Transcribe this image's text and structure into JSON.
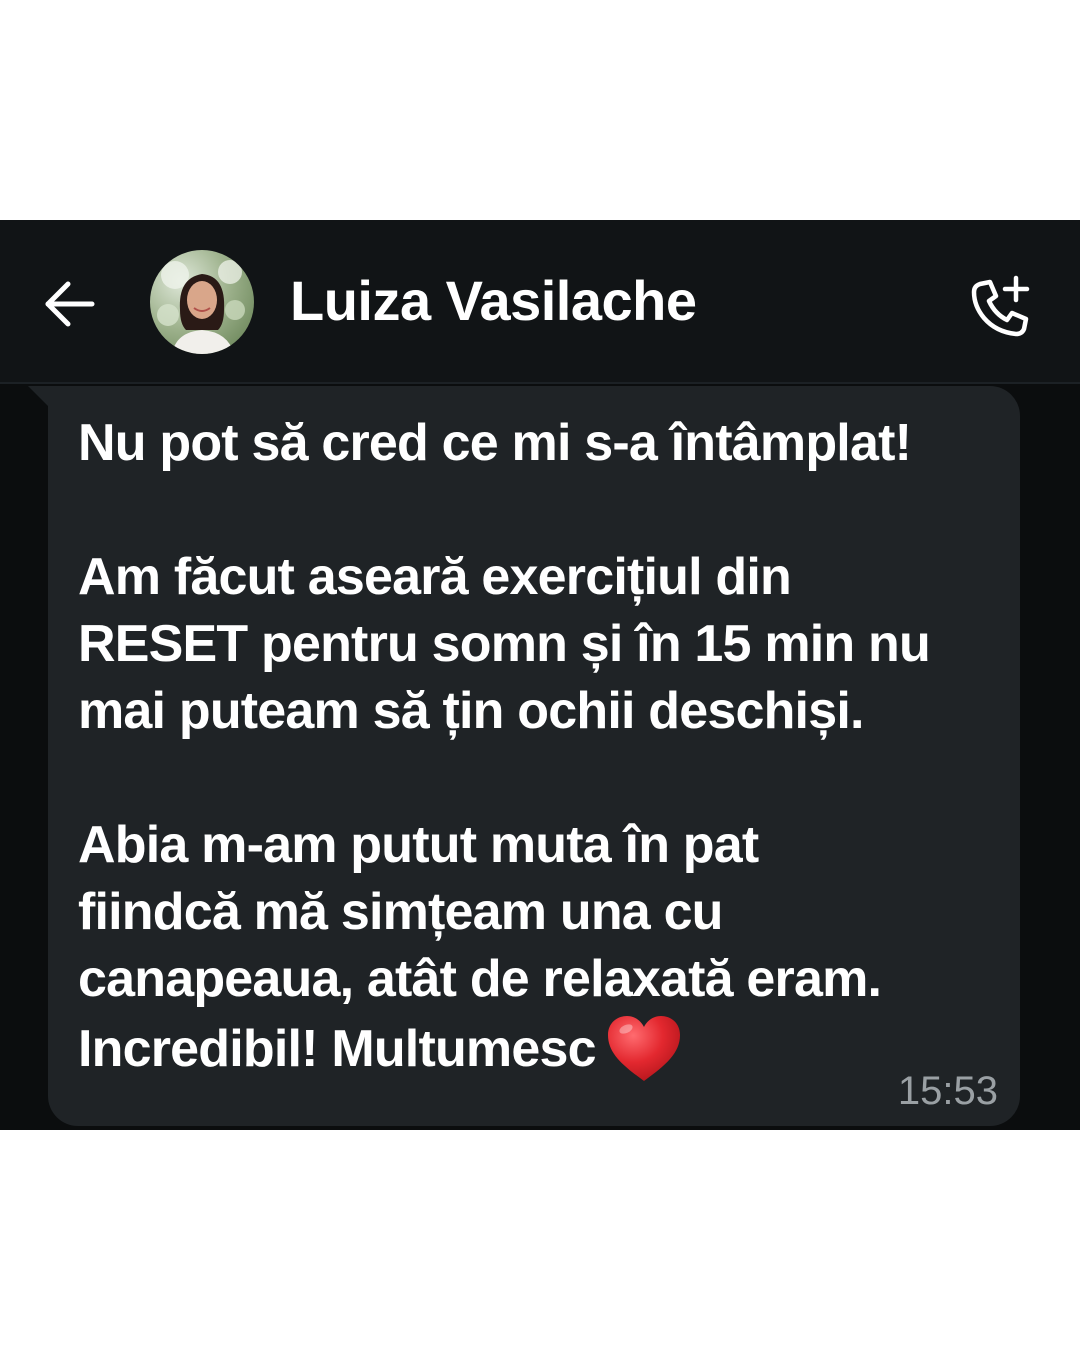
{
  "header": {
    "back_icon": "arrow-left-icon",
    "contact_name": "Luiza Vasilache",
    "call_icon": "phone-add-icon"
  },
  "message": {
    "line1": "Nu pot să cred ce mi s-a întâmplat!",
    "para2_line1": "Am făcut aseară exercițiul din",
    "para2_line2": "RESET pentru somn și în 15 min nu",
    "para2_line3": "mai puteam să țin ochii deschiși.",
    "para3_line1": "Abia m-am putut muta în pat",
    "para3_line2": "fiindcă mă simțeam una cu",
    "para3_line3": "canapeaua, atât de relaxată eram.",
    "para3_line4": "Incredibil! Multumesc",
    "emoji": "heart-icon",
    "time": "15:53"
  },
  "colors": {
    "background": "#0b0d0e",
    "header": "#111416",
    "bubble": "#1f2326",
    "text": "#ffffff",
    "timestamp": "#9aa0a4",
    "heart": "#e3282f"
  }
}
